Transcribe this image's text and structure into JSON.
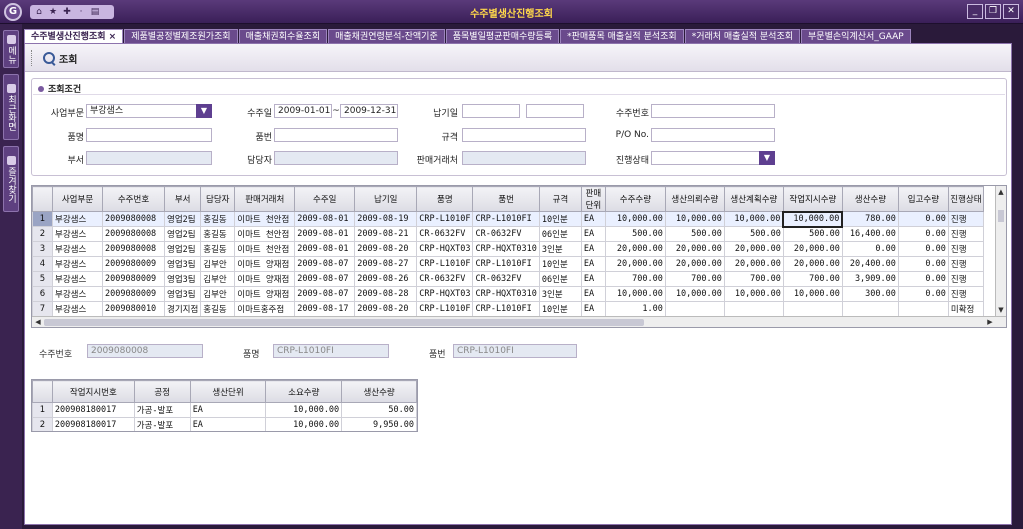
{
  "window": {
    "title": "수주별생산진행조회",
    "logo_letter": "G",
    "quick_icons": [
      "home-icon",
      "star-icon",
      "bookmark-icon",
      "dot-icon",
      "document-icon"
    ],
    "buttons": [
      "minimize-icon",
      "restore-icon",
      "close-icon"
    ]
  },
  "sidebar": {
    "tabs": [
      {
        "label": "메뉴",
        "icon": "menu-icon"
      },
      {
        "label": "최근화면",
        "icon": "recent-icon"
      },
      {
        "label": "즐겨찾기",
        "icon": "favorite-icon"
      }
    ]
  },
  "tabs": [
    {
      "label": "수주별생산진행조회",
      "close": "×",
      "active": true
    },
    {
      "label": "제품별공정별제조원가조회"
    },
    {
      "label": "매출채권회수율조회"
    },
    {
      "label": "매출채권연령분석-잔액기준"
    },
    {
      "label": "품목별일평균판매수량등록"
    },
    {
      "label": "*판매품목 매출실적 분석조회"
    },
    {
      "label": "*거래처 매출실적 분석조회"
    },
    {
      "label": "부문별손익계산서_GAAP"
    }
  ],
  "toolbar": {
    "search_label": "조회"
  },
  "conditions": {
    "title": "조회조건",
    "business_label": "사업부문",
    "business_value": "부강샘스",
    "order_date_label": "수주일",
    "order_date_from": "2009-01-01",
    "order_date_sep": "~",
    "order_date_to": "2009-12-31",
    "delivery_label": "납기일",
    "delivery_from": "",
    "delivery_to": "",
    "order_no_label": "수주번호",
    "order_no_value": "",
    "item_name_label": "품명",
    "item_no_label": "품번",
    "spec_label": "규격",
    "po_label": "P/O No.",
    "dept_label": "부서",
    "manager_label": "담당자",
    "customer_label": "판매거래처",
    "status_label": "진행상태"
  },
  "grid1": {
    "columns": [
      "사업부문",
      "수주번호",
      "부서",
      "담당자",
      "판매거래처",
      "수주일",
      "납기일",
      "품명",
      "품번",
      "규격",
      "판매\n단위",
      "수주수량",
      "생산의뢰수량",
      "생산계획수량",
      "작업지시수량",
      "생산수량",
      "입고수량",
      "진행상태"
    ],
    "rows": [
      {
        "n": "1",
        "c": [
          "부강샘스",
          "2009080008",
          "영업2팀",
          "홍길동",
          "이마트 천안점",
          "2009-08-01",
          "2009-08-19",
          "CRP-L1010F",
          "CRP-L1010FI",
          "10인분",
          "EA",
          "10,000.00",
          "10,000.00",
          "10,000.00",
          "10,000.00",
          "780.00",
          "0.00",
          "진행"
        ]
      },
      {
        "n": "2",
        "c": [
          "부강샘스",
          "2009080008",
          "영업2팀",
          "홍길동",
          "이마트 천안점",
          "2009-08-01",
          "2009-08-21",
          "CR-0632FV",
          "CR-0632FV",
          "06인분",
          "EA",
          "500.00",
          "500.00",
          "500.00",
          "500.00",
          "16,400.00",
          "0.00",
          "진행"
        ]
      },
      {
        "n": "3",
        "c": [
          "부강샘스",
          "2009080008",
          "영업2팀",
          "홍길동",
          "이마트 천안점",
          "2009-08-01",
          "2009-08-20",
          "CRP-HQXT03",
          "CRP-HQXT0310",
          "3인분",
          "EA",
          "20,000.00",
          "20,000.00",
          "20,000.00",
          "20,000.00",
          "0.00",
          "0.00",
          "진행"
        ]
      },
      {
        "n": "4",
        "c": [
          "부강샘스",
          "2009080009",
          "영업3팀",
          "김부안",
          "이마트 양재점",
          "2009-08-07",
          "2009-08-27",
          "CRP-L1010F",
          "CRP-L1010FI",
          "10인분",
          "EA",
          "20,000.00",
          "20,000.00",
          "20,000.00",
          "20,000.00",
          "20,400.00",
          "0.00",
          "진행"
        ]
      },
      {
        "n": "5",
        "c": [
          "부강샘스",
          "2009080009",
          "영업3팀",
          "김부안",
          "이마트 양재점",
          "2009-08-07",
          "2009-08-26",
          "CR-0632FV",
          "CR-0632FV",
          "06인분",
          "EA",
          "700.00",
          "700.00",
          "700.00",
          "700.00",
          "3,909.00",
          "0.00",
          "진행"
        ]
      },
      {
        "n": "6",
        "c": [
          "부강샘스",
          "2009080009",
          "영업3팀",
          "김부안",
          "이마트 양재점",
          "2009-08-07",
          "2009-08-28",
          "CRP-HQXT03",
          "CRP-HQXT0310",
          "3인분",
          "EA",
          "10,000.00",
          "10,000.00",
          "10,000.00",
          "10,000.00",
          "300.00",
          "0.00",
          "진행"
        ]
      },
      {
        "n": "7",
        "c": [
          "부강샘스",
          "2009080010",
          "경기지점",
          "홍길동",
          "이마트홍주점",
          "2009-08-17",
          "2009-08-20",
          "CRP-L1010F",
          "CRP-L1010FI",
          "10인분",
          "EA",
          "1.00",
          "",
          "",
          "",
          "",
          "",
          "미확정"
        ]
      }
    ]
  },
  "detail": {
    "order_no_label": "수주번호",
    "order_no_value": "2009080008",
    "item_name_label": "품명",
    "item_name_value": "CRP-L1010FI",
    "item_no_label": "품번",
    "item_no_value": "CRP-L1010FI"
  },
  "grid2": {
    "columns": [
      "작업지시번호",
      "공정",
      "생산단위",
      "소요수량",
      "생산수량"
    ],
    "rows": [
      {
        "n": "1",
        "c": [
          "200908180017",
          "가공-발포",
          "EA",
          "10,000.00",
          "50.00"
        ]
      },
      {
        "n": "2",
        "c": [
          "200908180017",
          "가공-발포",
          "EA",
          "10,000.00",
          "9,950.00"
        ]
      }
    ]
  },
  "colors": {
    "accent": "#5e3f90",
    "title_text": "#ffd84a",
    "frame": "#3a2350"
  }
}
